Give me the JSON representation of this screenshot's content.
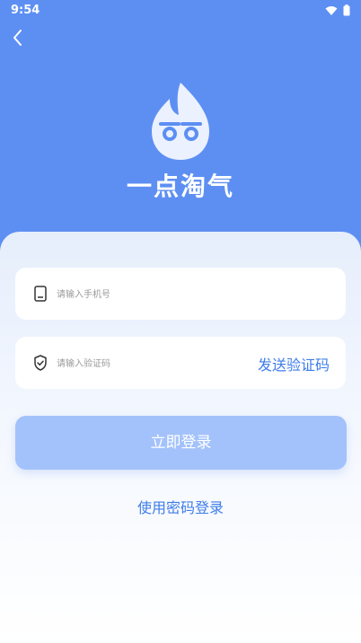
{
  "status_bar": {
    "time": "9:54",
    "icons": [
      "wifi-icon",
      "battery-icon"
    ]
  },
  "header": {
    "back_icon": "chevron-left-icon",
    "app_name": "一点淘气",
    "logo_icon": "flame-logo-icon"
  },
  "login": {
    "phone_placeholder": "请输入手机号",
    "code_placeholder": "请输入验证码",
    "send_code_label": "发送验证码",
    "submit_label": "立即登录",
    "password_login_label": "使用密码登录"
  },
  "colors": {
    "primary": "#5d8ff3",
    "accent": "#3f7de8",
    "button": "#a3c2fb"
  }
}
